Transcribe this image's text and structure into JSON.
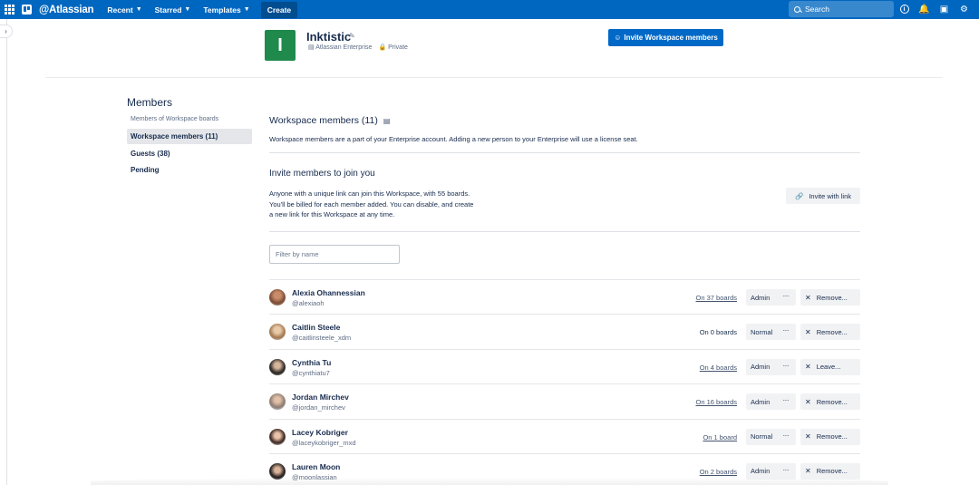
{
  "nav": {
    "brand": "@Atlassian",
    "menu": [
      {
        "label": "Recent"
      },
      {
        "label": "Starred"
      },
      {
        "label": "Templates"
      }
    ],
    "create_label": "Create",
    "search_placeholder": "Search"
  },
  "workspace": {
    "logo_letter": "I",
    "logo_color": "#1f8a4c",
    "name": "Inktistic",
    "plan": "Atlassian Enterprise",
    "visibility": "Private",
    "invite_button": "Invite Workspace members"
  },
  "sidebar": {
    "title": "Members",
    "subtitle": "Members of Workspace boards",
    "items": [
      {
        "label": "Workspace members (11)",
        "active": true
      },
      {
        "label": "Guests (38)",
        "active": false
      },
      {
        "label": "Pending",
        "active": false
      }
    ]
  },
  "main": {
    "title": "Workspace members (11)",
    "description": "Workspace members are a part of your Enterprise account. Adding a new person to your Enterprise will use a license seat.",
    "invite_title": "Invite members to join you",
    "invite_desc_lines": [
      "Anyone with a unique link can join this Workspace, with 55 boards.",
      "You'll be billed for each member added. You can disable, and create",
      "a new link for this Workspace at any time."
    ],
    "invite_link_button": "Invite with link",
    "filter_placeholder": "Filter by name"
  },
  "members": [
    {
      "name": "Alexia Ohannessian",
      "handle": "@alexiaoh",
      "boards": "On 37 boards",
      "boards_link": true,
      "role": "Admin",
      "action": "Remove..."
    },
    {
      "name": "Caitlin Steele",
      "handle": "@caitlinsteele_xdm",
      "boards": "On 0 boards",
      "boards_link": false,
      "role": "Normal",
      "action": "Remove..."
    },
    {
      "name": "Cynthia Tu",
      "handle": "@cynthiatu7",
      "boards": "On 4 boards",
      "boards_link": true,
      "role": "Admin",
      "action": "Leave..."
    },
    {
      "name": "Jordan Mirchev",
      "handle": "@jordan_mirchev",
      "boards": "On 16 boards",
      "boards_link": true,
      "role": "Admin",
      "action": "Remove..."
    },
    {
      "name": "Lacey Kobriger",
      "handle": "@laceykobriger_mxd",
      "boards": "On 1 board",
      "boards_link": true,
      "role": "Normal",
      "action": "Remove..."
    },
    {
      "name": "Lauren Moon",
      "handle": "@moonlassian",
      "boards": "On 2 boards",
      "boards_link": true,
      "role": "Admin",
      "action": "Remove..."
    }
  ],
  "colors": {
    "nav_bg": "#0067c0",
    "primary_button": "#0069c7",
    "active_menu_bg": "#e4e6ea"
  }
}
